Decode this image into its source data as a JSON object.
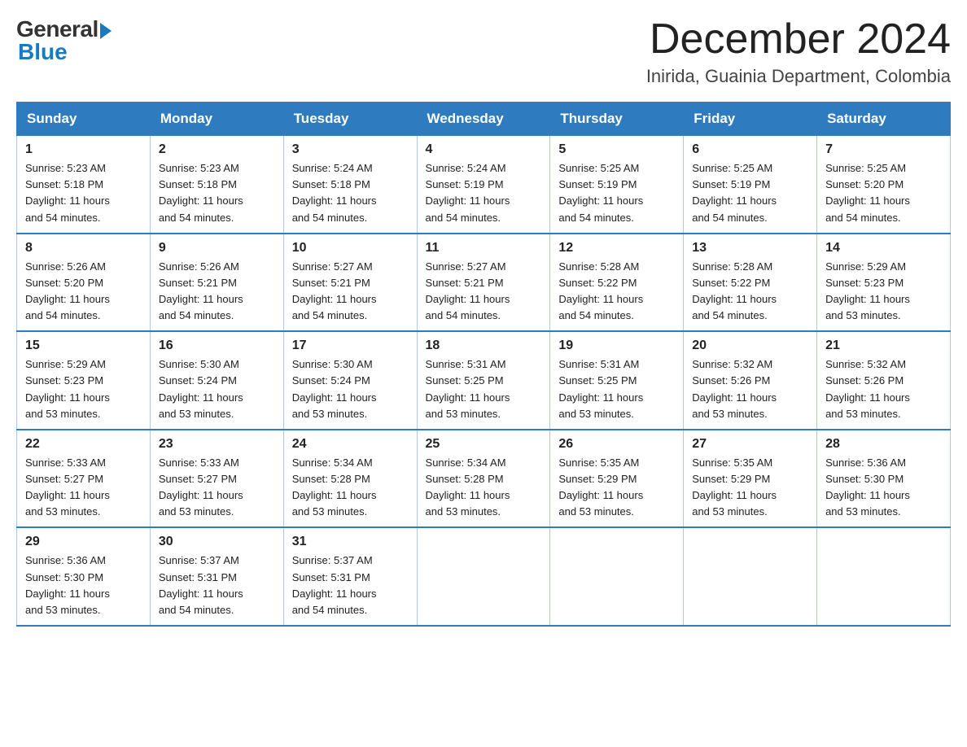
{
  "logo": {
    "general": "General",
    "blue": "Blue"
  },
  "header": {
    "month_year": "December 2024",
    "location": "Inirida, Guainia Department, Colombia"
  },
  "weekdays": [
    "Sunday",
    "Monday",
    "Tuesday",
    "Wednesday",
    "Thursday",
    "Friday",
    "Saturday"
  ],
  "weeks": [
    [
      {
        "day": "1",
        "sunrise": "5:23 AM",
        "sunset": "5:18 PM",
        "daylight": "11 hours and 54 minutes."
      },
      {
        "day": "2",
        "sunrise": "5:23 AM",
        "sunset": "5:18 PM",
        "daylight": "11 hours and 54 minutes."
      },
      {
        "day": "3",
        "sunrise": "5:24 AM",
        "sunset": "5:18 PM",
        "daylight": "11 hours and 54 minutes."
      },
      {
        "day": "4",
        "sunrise": "5:24 AM",
        "sunset": "5:19 PM",
        "daylight": "11 hours and 54 minutes."
      },
      {
        "day": "5",
        "sunrise": "5:25 AM",
        "sunset": "5:19 PM",
        "daylight": "11 hours and 54 minutes."
      },
      {
        "day": "6",
        "sunrise": "5:25 AM",
        "sunset": "5:19 PM",
        "daylight": "11 hours and 54 minutes."
      },
      {
        "day": "7",
        "sunrise": "5:25 AM",
        "sunset": "5:20 PM",
        "daylight": "11 hours and 54 minutes."
      }
    ],
    [
      {
        "day": "8",
        "sunrise": "5:26 AM",
        "sunset": "5:20 PM",
        "daylight": "11 hours and 54 minutes."
      },
      {
        "day": "9",
        "sunrise": "5:26 AM",
        "sunset": "5:21 PM",
        "daylight": "11 hours and 54 minutes."
      },
      {
        "day": "10",
        "sunrise": "5:27 AM",
        "sunset": "5:21 PM",
        "daylight": "11 hours and 54 minutes."
      },
      {
        "day": "11",
        "sunrise": "5:27 AM",
        "sunset": "5:21 PM",
        "daylight": "11 hours and 54 minutes."
      },
      {
        "day": "12",
        "sunrise": "5:28 AM",
        "sunset": "5:22 PM",
        "daylight": "11 hours and 54 minutes."
      },
      {
        "day": "13",
        "sunrise": "5:28 AM",
        "sunset": "5:22 PM",
        "daylight": "11 hours and 54 minutes."
      },
      {
        "day": "14",
        "sunrise": "5:29 AM",
        "sunset": "5:23 PM",
        "daylight": "11 hours and 53 minutes."
      }
    ],
    [
      {
        "day": "15",
        "sunrise": "5:29 AM",
        "sunset": "5:23 PM",
        "daylight": "11 hours and 53 minutes."
      },
      {
        "day": "16",
        "sunrise": "5:30 AM",
        "sunset": "5:24 PM",
        "daylight": "11 hours and 53 minutes."
      },
      {
        "day": "17",
        "sunrise": "5:30 AM",
        "sunset": "5:24 PM",
        "daylight": "11 hours and 53 minutes."
      },
      {
        "day": "18",
        "sunrise": "5:31 AM",
        "sunset": "5:25 PM",
        "daylight": "11 hours and 53 minutes."
      },
      {
        "day": "19",
        "sunrise": "5:31 AM",
        "sunset": "5:25 PM",
        "daylight": "11 hours and 53 minutes."
      },
      {
        "day": "20",
        "sunrise": "5:32 AM",
        "sunset": "5:26 PM",
        "daylight": "11 hours and 53 minutes."
      },
      {
        "day": "21",
        "sunrise": "5:32 AM",
        "sunset": "5:26 PM",
        "daylight": "11 hours and 53 minutes."
      }
    ],
    [
      {
        "day": "22",
        "sunrise": "5:33 AM",
        "sunset": "5:27 PM",
        "daylight": "11 hours and 53 minutes."
      },
      {
        "day": "23",
        "sunrise": "5:33 AM",
        "sunset": "5:27 PM",
        "daylight": "11 hours and 53 minutes."
      },
      {
        "day": "24",
        "sunrise": "5:34 AM",
        "sunset": "5:28 PM",
        "daylight": "11 hours and 53 minutes."
      },
      {
        "day": "25",
        "sunrise": "5:34 AM",
        "sunset": "5:28 PM",
        "daylight": "11 hours and 53 minutes."
      },
      {
        "day": "26",
        "sunrise": "5:35 AM",
        "sunset": "5:29 PM",
        "daylight": "11 hours and 53 minutes."
      },
      {
        "day": "27",
        "sunrise": "5:35 AM",
        "sunset": "5:29 PM",
        "daylight": "11 hours and 53 minutes."
      },
      {
        "day": "28",
        "sunrise": "5:36 AM",
        "sunset": "5:30 PM",
        "daylight": "11 hours and 53 minutes."
      }
    ],
    [
      {
        "day": "29",
        "sunrise": "5:36 AM",
        "sunset": "5:30 PM",
        "daylight": "11 hours and 53 minutes."
      },
      {
        "day": "30",
        "sunrise": "5:37 AM",
        "sunset": "5:31 PM",
        "daylight": "11 hours and 54 minutes."
      },
      {
        "day": "31",
        "sunrise": "5:37 AM",
        "sunset": "5:31 PM",
        "daylight": "11 hours and 54 minutes."
      },
      null,
      null,
      null,
      null
    ]
  ],
  "labels": {
    "sunrise": "Sunrise:",
    "sunset": "Sunset:",
    "daylight": "Daylight:"
  }
}
